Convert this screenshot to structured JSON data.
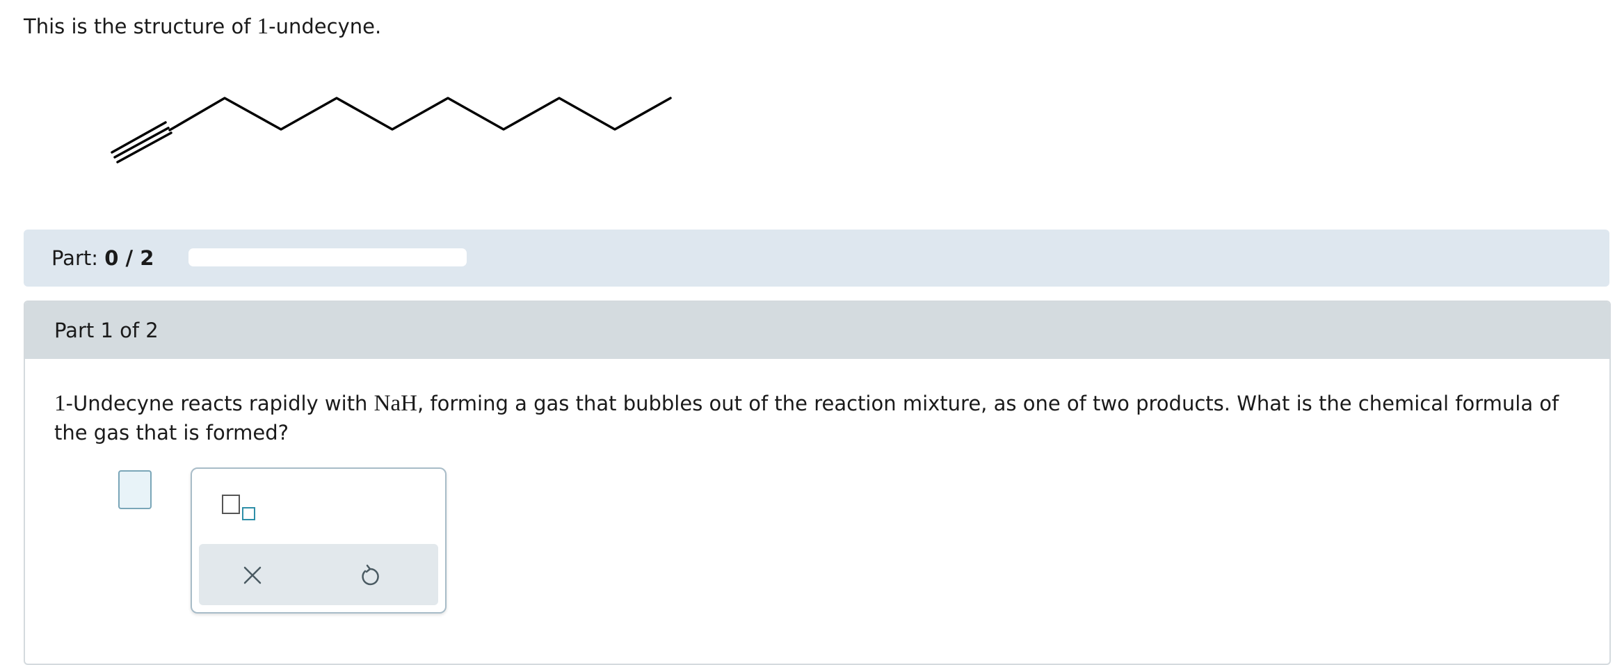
{
  "intro": {
    "prefix": "This is the structure of ",
    "number": "1",
    "suffix": "-undecyne."
  },
  "part_bar": {
    "label": "Part:",
    "progress_text": "0 / 2",
    "progress_fraction": 0
  },
  "part_card": {
    "header": "Part 1 of 2",
    "question": {
      "num": "1",
      "text1": "-Undecyne reacts rapidly with ",
      "reagent": "NaH",
      "text2": ", forming a gas that bubbles out of the reaction mixture, as one of two products. What is the chemical formula of the gas that is formed?"
    }
  },
  "tools": {
    "subscript_icon": "subscript-template-icon",
    "clear_icon": "x-icon",
    "undo_icon": "undo-icon"
  },
  "colors": {
    "part_bar_bg": "#dee7ef",
    "card_header_bg": "#d4dbdf",
    "answer_box_border": "#7aa6b8",
    "icon_accent": "#2e8fa8"
  }
}
